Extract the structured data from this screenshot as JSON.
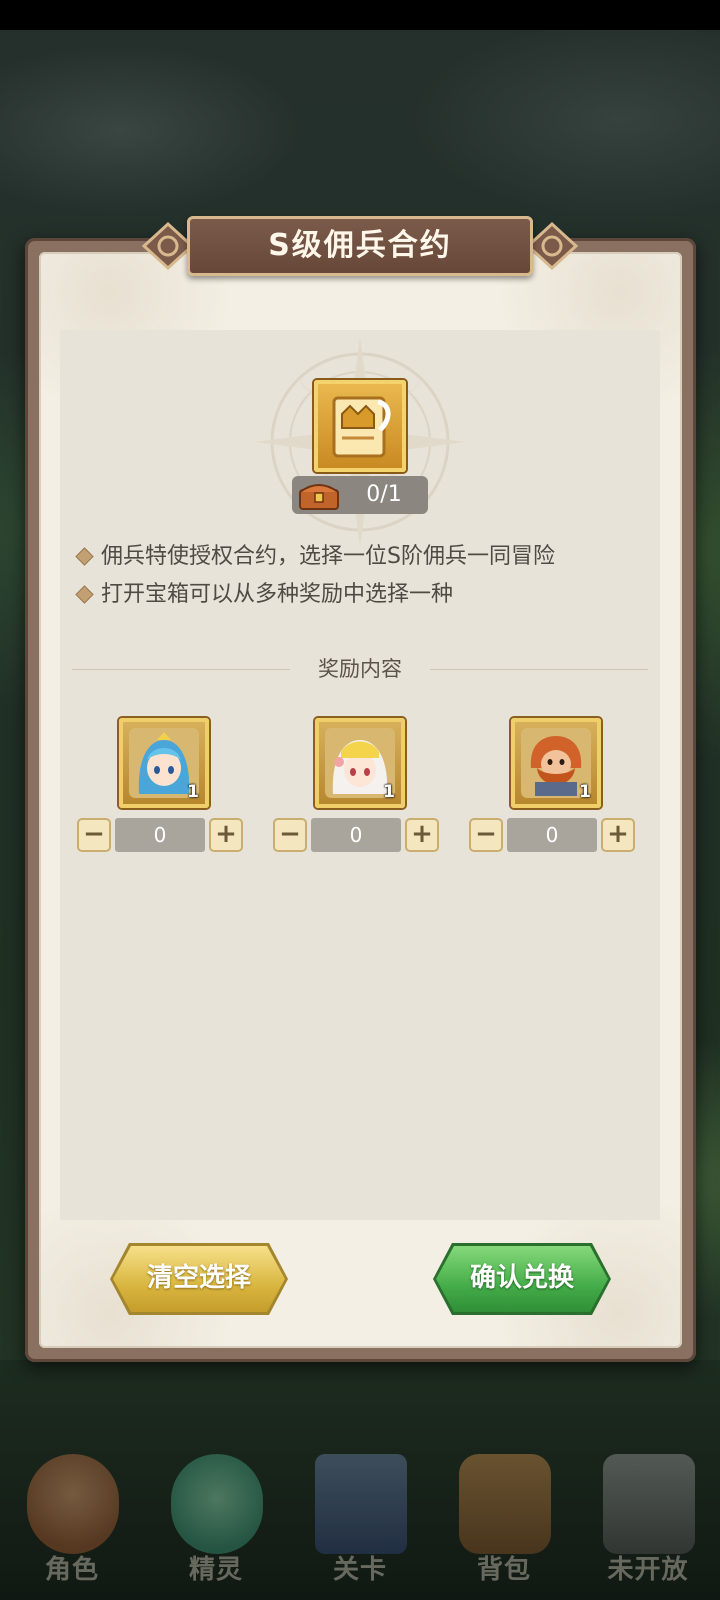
{
  "dialog": {
    "title": "S级佣兵合约",
    "counter": "0/1",
    "descriptions": [
      "佣兵特使授权合约，选择一位S阶佣兵一同冒险",
      "打开宝箱可以从多种奖励中选择一种"
    ],
    "reward_section_title": "奖励内容",
    "rewards": [
      {
        "count": "1",
        "value": "0",
        "minus": "−",
        "plus": "+"
      },
      {
        "count": "1",
        "value": "0",
        "minus": "−",
        "plus": "+"
      },
      {
        "count": "1",
        "value": "0",
        "minus": "−",
        "plus": "+"
      }
    ],
    "clear_button": "清空选择",
    "confirm_button": "确认兑换"
  },
  "bottom_nav": [
    {
      "label": "角色",
      "icon": "character-icon"
    },
    {
      "label": "精灵",
      "icon": "spirit-icon"
    },
    {
      "label": "关卡",
      "icon": "stage-icon"
    },
    {
      "label": "背包",
      "icon": "backpack-icon"
    },
    {
      "label": "未开放",
      "icon": "locked-icon"
    }
  ],
  "colors": {
    "panel_bg": "#f3efe4",
    "title_banner": "#6f4f40",
    "clear_button": "#d9b640",
    "confirm_button": "#45ad49"
  }
}
